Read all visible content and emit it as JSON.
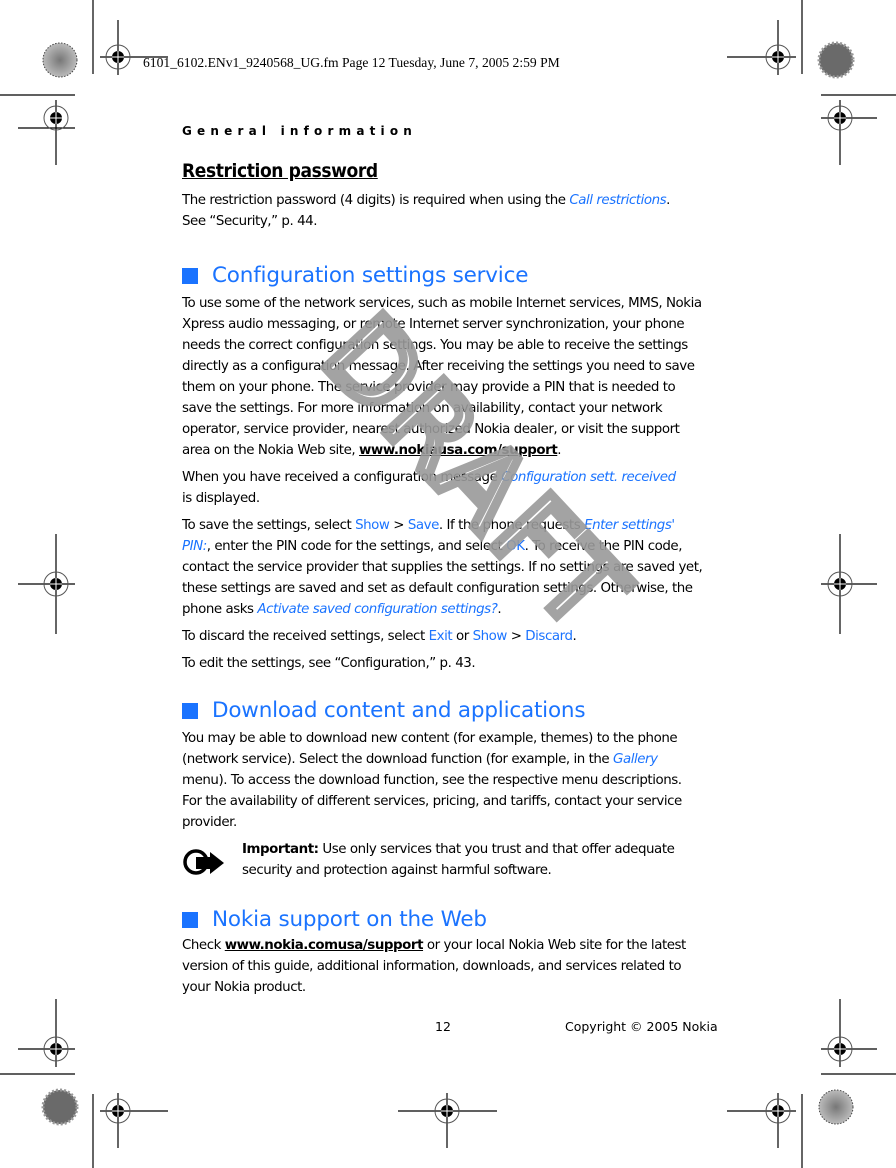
{
  "slug": "6101_6102.ENv1_9240568_UG.fm  Page 12  Tuesday, June 7, 2005  2:59 PM",
  "running_head": "General information",
  "restriction": {
    "title": "Restriction password",
    "p1_a": "The restriction password (4 digits) is required when using the ",
    "p1_link": "Call restrictions",
    "p1_b": ".",
    "p1_c": "See “Security,” p. 44."
  },
  "config": {
    "title": "Configuration settings service",
    "p1_a": "To use some of the network services, such as mobile Internet services, MMS, Nokia Xpress audio messaging, or remote Internet server synchronization, your phone needs the correct configuration settings. You may be able to receive the settings directly as a configuration message. After receiving the settings you need to save them on your phone. The service provider may provide a PIN that is needed to save the settings. For more information on availability, contact your network operator, service provider, nearest authorized Nokia dealer, or visit the support area on the Nokia Web site, ",
    "p1_url": "www.nokiausa.com/support",
    "p1_b": ".",
    "p2_a": "When you have received a configuration message ",
    "p2_link": "Configuration sett. received",
    "p2_b": " is displayed.",
    "p3_a": "To save the settings, select ",
    "p3_show": "Show",
    "p3_gt": " > ",
    "p3_save": "Save",
    "p3_b": ". If the phone requests ",
    "p3_pin": "Enter settings' PIN:",
    "p3_c": ", enter the PIN code for the settings, and select ",
    "p3_ok": "OK",
    "p3_d": ". To receive the PIN code, contact the service provider that supplies the settings. If no settings are saved yet, these settings are saved and set as default configuration settings. Otherwise, the phone asks ",
    "p3_activate": "Activate saved configuration settings?",
    "p3_e": ".",
    "p4_a": "To discard the received settings, select ",
    "p4_exit": "Exit",
    "p4_or": " or ",
    "p4_show": "Show",
    "p4_gt": " > ",
    "p4_discard": "Discard",
    "p4_b": ".",
    "p5": "To edit the settings, see “Configuration,” p. 43."
  },
  "download": {
    "title": "Download content and applications",
    "p1_a": "You may be able to download new content (for example, themes) to the phone (network service). Select the download function (for example, in the ",
    "p1_link": "Gallery",
    "p1_b": " menu). To access the download function, see the respective menu descriptions. For the availability of different services, pricing, and tariffs, contact your service provider.",
    "note_label": "Important:",
    "note_text": " Use only services that you trust and that offer adequate security and protection against harmful software.",
    "note_icon": "important-icon"
  },
  "support": {
    "title": "Nokia support on the Web",
    "p1_a": "Check ",
    "p1_url": "www.nokia.comusa/support",
    "p1_b": " or your local Nokia Web site for the latest version of this guide, additional information, downloads, and services related to your Nokia product."
  },
  "watermark": "DRAFT",
  "footer": {
    "page_number": "12",
    "copyright": "Copyright © 2005 Nokia"
  },
  "colors": {
    "accent": "#1a73ff",
    "watermark": "#9a9a9a"
  }
}
